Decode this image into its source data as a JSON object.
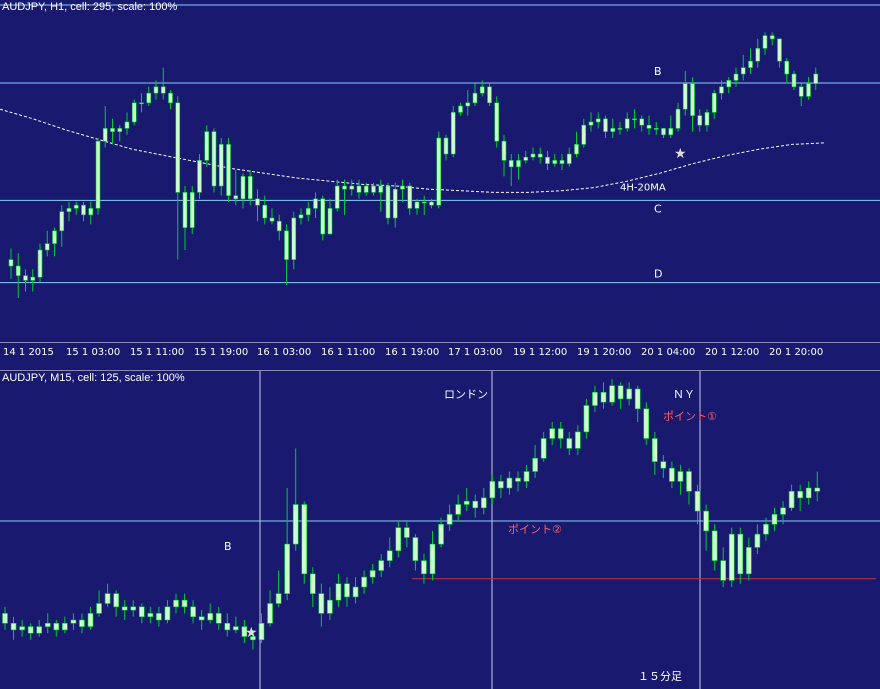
{
  "colors": {
    "background": "#191970",
    "bull": "#ccffcc",
    "bear": "#ccffcc",
    "wick": "#00cc33",
    "level": "#87cefa",
    "vline": "#c8c8e8",
    "ma": "#ffffff",
    "red_line": "#cc3333",
    "point_text": "#ff6060",
    "label_text": "#ffffff"
  },
  "h1": {
    "title": "AUDJPY, H1, cell: 295, scale: 100%",
    "x_ticks": [
      "14 1 2015",
      "15 1 03:00",
      "15 1 11:00",
      "15 1 19:00",
      "16 1 03:00",
      "16 1 11:00",
      "16 1 19:00",
      "17 1 03:00",
      "19 1 12:00",
      "19 1 20:00",
      "20 1 04:00",
      "20 1 12:00",
      "20 1 20:00"
    ],
    "level_B": "B",
    "level_C": "C",
    "level_D": "D",
    "ma_label": "4H-20MA",
    "star": "★"
  },
  "m15": {
    "title": "AUDJPY, M15, cell: 125, scale: 100%",
    "label_london": "ロンドン",
    "label_ny": "ＮＹ",
    "label_point1": "ポイント①",
    "label_point2": "ポイント②",
    "label_b": "B",
    "label_15": "１５分足",
    "star": "★"
  },
  "chart_data": [
    {
      "type": "candlestick",
      "title": "AUDJPY, H1, cell: 295, scale: 100%",
      "ylim": [
        0,
        1
      ],
      "levels": [
        {
          "name": "B",
          "y": 0.772
        },
        {
          "name": "C",
          "y": 0.405
        },
        {
          "name": "D",
          "y": 0.148
        }
      ],
      "ma_name": "4H-20MA",
      "ma": [
        0.69,
        0.66,
        0.625,
        0.595,
        0.565,
        0.545,
        0.525,
        0.505,
        0.49,
        0.475,
        0.465,
        0.455,
        0.45,
        0.44,
        0.435,
        0.43,
        0.43,
        0.435,
        0.445,
        0.465,
        0.49,
        0.52,
        0.545,
        0.565,
        0.58,
        0.585
      ],
      "candles": [
        [
          0.22,
          0.2,
          0.255,
          0.16
        ],
        [
          0.2,
          0.17,
          0.24,
          0.1
        ],
        [
          0.17,
          0.155,
          0.19,
          0.12
        ],
        [
          0.155,
          0.165,
          0.19,
          0.12
        ],
        [
          0.165,
          0.25,
          0.27,
          0.15
        ],
        [
          0.25,
          0.27,
          0.31,
          0.23
        ],
        [
          0.27,
          0.31,
          0.32,
          0.23
        ],
        [
          0.31,
          0.37,
          0.39,
          0.26
        ],
        [
          0.37,
          0.38,
          0.4,
          0.34
        ],
        [
          0.38,
          0.39,
          0.4,
          0.36
        ],
        [
          0.39,
          0.36,
          0.4,
          0.34
        ],
        [
          0.36,
          0.38,
          0.4,
          0.33
        ],
        [
          0.38,
          0.59,
          0.6,
          0.36
        ],
        [
          0.59,
          0.63,
          0.7,
          0.57
        ],
        [
          0.63,
          0.62,
          0.66,
          0.58
        ],
        [
          0.62,
          0.63,
          0.64,
          0.59
        ],
        [
          0.63,
          0.65,
          0.68,
          0.61
        ],
        [
          0.65,
          0.71,
          0.72,
          0.64
        ],
        [
          0.71,
          0.71,
          0.74,
          0.68
        ],
        [
          0.71,
          0.74,
          0.76,
          0.7
        ],
        [
          0.74,
          0.76,
          0.78,
          0.72
        ],
        [
          0.76,
          0.74,
          0.82,
          0.72
        ],
        [
          0.74,
          0.71,
          0.75,
          0.69
        ],
        [
          0.71,
          0.43,
          0.73,
          0.22
        ],
        [
          0.43,
          0.32,
          0.45,
          0.25
        ],
        [
          0.32,
          0.43,
          0.45,
          0.3
        ],
        [
          0.43,
          0.53,
          0.55,
          0.41
        ],
        [
          0.53,
          0.62,
          0.64,
          0.51
        ],
        [
          0.62,
          0.45,
          0.63,
          0.43
        ],
        [
          0.45,
          0.58,
          0.6,
          0.42
        ],
        [
          0.58,
          0.42,
          0.6,
          0.4
        ],
        [
          0.42,
          0.41,
          0.5,
          0.39
        ],
        [
          0.41,
          0.48,
          0.49,
          0.38
        ],
        [
          0.48,
          0.41,
          0.5,
          0.39
        ],
        [
          0.41,
          0.39,
          0.44,
          0.34
        ],
        [
          0.39,
          0.35,
          0.42,
          0.33
        ],
        [
          0.35,
          0.34,
          0.38,
          0.33
        ],
        [
          0.34,
          0.31,
          0.36,
          0.28
        ],
        [
          0.31,
          0.22,
          0.33,
          0.14
        ],
        [
          0.22,
          0.35,
          0.37,
          0.19
        ],
        [
          0.35,
          0.36,
          0.38,
          0.33
        ],
        [
          0.36,
          0.38,
          0.4,
          0.34
        ],
        [
          0.38,
          0.41,
          0.43,
          0.35
        ],
        [
          0.41,
          0.3,
          0.42,
          0.28
        ],
        [
          0.3,
          0.38,
          0.41,
          0.36
        ],
        [
          0.38,
          0.45,
          0.47,
          0.37
        ],
        [
          0.45,
          0.44,
          0.47,
          0.36
        ],
        [
          0.44,
          0.45,
          0.47,
          0.42
        ],
        [
          0.45,
          0.43,
          0.47,
          0.41
        ],
        [
          0.43,
          0.45,
          0.46,
          0.42
        ],
        [
          0.45,
          0.43,
          0.46,
          0.42
        ],
        [
          0.43,
          0.45,
          0.47,
          0.37
        ],
        [
          0.45,
          0.35,
          0.46,
          0.33
        ],
        [
          0.35,
          0.44,
          0.46,
          0.32
        ],
        [
          0.44,
          0.45,
          0.47,
          0.4
        ],
        [
          0.45,
          0.38,
          0.46,
          0.36
        ],
        [
          0.38,
          0.4,
          0.41,
          0.36
        ],
        [
          0.4,
          0.4,
          0.42,
          0.36
        ],
        [
          0.4,
          0.39,
          0.41,
          0.38
        ],
        [
          0.39,
          0.6,
          0.62,
          0.38
        ],
        [
          0.6,
          0.55,
          0.61,
          0.53
        ],
        [
          0.55,
          0.68,
          0.7,
          0.54
        ],
        [
          0.68,
          0.7,
          0.71,
          0.67
        ],
        [
          0.7,
          0.71,
          0.75,
          0.67
        ],
        [
          0.71,
          0.74,
          0.77,
          0.7
        ],
        [
          0.74,
          0.76,
          0.78,
          0.73
        ],
        [
          0.76,
          0.71,
          0.77,
          0.7
        ],
        [
          0.71,
          0.59,
          0.73,
          0.57
        ],
        [
          0.59,
          0.53,
          0.61,
          0.48
        ],
        [
          0.53,
          0.51,
          0.55,
          0.45
        ],
        [
          0.51,
          0.53,
          0.55,
          0.47
        ],
        [
          0.53,
          0.54,
          0.56,
          0.52
        ],
        [
          0.54,
          0.55,
          0.57,
          0.53
        ],
        [
          0.55,
          0.54,
          0.57,
          0.52
        ],
        [
          0.54,
          0.52,
          0.56,
          0.5
        ],
        [
          0.52,
          0.53,
          0.55,
          0.51
        ],
        [
          0.53,
          0.52,
          0.55,
          0.5
        ],
        [
          0.52,
          0.55,
          0.57,
          0.51
        ],
        [
          0.55,
          0.58,
          0.62,
          0.54
        ],
        [
          0.58,
          0.64,
          0.66,
          0.57
        ],
        [
          0.64,
          0.65,
          0.68,
          0.62
        ],
        [
          0.65,
          0.66,
          0.68,
          0.63
        ],
        [
          0.66,
          0.62,
          0.67,
          0.6
        ],
        [
          0.62,
          0.63,
          0.66,
          0.6
        ],
        [
          0.63,
          0.63,
          0.65,
          0.61
        ],
        [
          0.63,
          0.66,
          0.68,
          0.62
        ],
        [
          0.66,
          0.66,
          0.69,
          0.63
        ],
        [
          0.66,
          0.64,
          0.67,
          0.62
        ],
        [
          0.64,
          0.63,
          0.67,
          0.61
        ],
        [
          0.63,
          0.63,
          0.65,
          0.61
        ],
        [
          0.63,
          0.61,
          0.63,
          0.6
        ],
        [
          0.61,
          0.63,
          0.67,
          0.6
        ],
        [
          0.63,
          0.69,
          0.71,
          0.62
        ],
        [
          0.69,
          0.77,
          0.81,
          0.67
        ],
        [
          0.77,
          0.67,
          0.79,
          0.62
        ],
        [
          0.67,
          0.64,
          0.69,
          0.62
        ],
        [
          0.64,
          0.68,
          0.69,
          0.62
        ],
        [
          0.68,
          0.74,
          0.75,
          0.66
        ],
        [
          0.74,
          0.76,
          0.78,
          0.72
        ],
        [
          0.76,
          0.78,
          0.79,
          0.74
        ],
        [
          0.78,
          0.8,
          0.82,
          0.76
        ],
        [
          0.8,
          0.82,
          0.86,
          0.78
        ],
        [
          0.82,
          0.84,
          0.88,
          0.8
        ],
        [
          0.84,
          0.88,
          0.91,
          0.82
        ],
        [
          0.88,
          0.92,
          0.93,
          0.86
        ],
        [
          0.92,
          0.91,
          0.93,
          0.89
        ],
        [
          0.91,
          0.84,
          0.91,
          0.82
        ],
        [
          0.84,
          0.8,
          0.85,
          0.77
        ],
        [
          0.8,
          0.76,
          0.81,
          0.75
        ],
        [
          0.76,
          0.73,
          0.77,
          0.7
        ],
        [
          0.73,
          0.77,
          0.79,
          0.72
        ],
        [
          0.77,
          0.8,
          0.82,
          0.75
        ]
      ]
    },
    {
      "type": "candlestick",
      "title": "AUDJPY, M15, cell: 125, scale: 100%",
      "ylim": [
        0,
        1
      ],
      "levels": [
        {
          "name": "B",
          "y": 0.5
        },
        {
          "name": "red_support",
          "y": 0.325
        }
      ],
      "annotations": [
        "ロンドン",
        "ＮＹ",
        "ポイント①",
        "ポイント②",
        "１５分足"
      ],
      "candles": [
        [
          0.22,
          0.19,
          0.24,
          0.17
        ],
        [
          0.19,
          0.17,
          0.21,
          0.14
        ],
        [
          0.17,
          0.18,
          0.2,
          0.15
        ],
        [
          0.18,
          0.16,
          0.19,
          0.14
        ],
        [
          0.16,
          0.18,
          0.2,
          0.15
        ],
        [
          0.18,
          0.19,
          0.22,
          0.16
        ],
        [
          0.19,
          0.17,
          0.2,
          0.15
        ],
        [
          0.17,
          0.19,
          0.21,
          0.16
        ],
        [
          0.19,
          0.2,
          0.22,
          0.17
        ],
        [
          0.2,
          0.18,
          0.22,
          0.16
        ],
        [
          0.18,
          0.22,
          0.24,
          0.17
        ],
        [
          0.22,
          0.25,
          0.29,
          0.21
        ],
        [
          0.25,
          0.28,
          0.31,
          0.24
        ],
        [
          0.28,
          0.24,
          0.29,
          0.21
        ],
        [
          0.24,
          0.23,
          0.26,
          0.2
        ],
        [
          0.23,
          0.24,
          0.26,
          0.21
        ],
        [
          0.24,
          0.21,
          0.25,
          0.19
        ],
        [
          0.21,
          0.22,
          0.24,
          0.19
        ],
        [
          0.22,
          0.2,
          0.24,
          0.18
        ],
        [
          0.2,
          0.24,
          0.26,
          0.19
        ],
        [
          0.24,
          0.26,
          0.28,
          0.22
        ],
        [
          0.26,
          0.24,
          0.28,
          0.22
        ],
        [
          0.24,
          0.21,
          0.26,
          0.19
        ],
        [
          0.21,
          0.2,
          0.23,
          0.17
        ],
        [
          0.2,
          0.22,
          0.25,
          0.19
        ],
        [
          0.22,
          0.19,
          0.24,
          0.17
        ],
        [
          0.19,
          0.17,
          0.22,
          0.15
        ],
        [
          0.17,
          0.18,
          0.21,
          0.16
        ],
        [
          0.18,
          0.15,
          0.2,
          0.13
        ],
        [
          0.15,
          0.14,
          0.17,
          0.11
        ],
        [
          0.14,
          0.19,
          0.22,
          0.13
        ],
        [
          0.19,
          0.25,
          0.29,
          0.18
        ],
        [
          0.25,
          0.28,
          0.35,
          0.24
        ],
        [
          0.28,
          0.43,
          0.6,
          0.26
        ],
        [
          0.43,
          0.55,
          0.72,
          0.41
        ],
        [
          0.55,
          0.34,
          0.56,
          0.31
        ],
        [
          0.34,
          0.28,
          0.36,
          0.24
        ],
        [
          0.28,
          0.22,
          0.31,
          0.18
        ],
        [
          0.22,
          0.26,
          0.3,
          0.2
        ],
        [
          0.26,
          0.31,
          0.34,
          0.24
        ],
        [
          0.31,
          0.27,
          0.33,
          0.24
        ],
        [
          0.27,
          0.3,
          0.33,
          0.25
        ],
        [
          0.3,
          0.33,
          0.35,
          0.28
        ],
        [
          0.33,
          0.35,
          0.37,
          0.31
        ],
        [
          0.35,
          0.38,
          0.4,
          0.33
        ],
        [
          0.38,
          0.41,
          0.45,
          0.36
        ],
        [
          0.41,
          0.48,
          0.5,
          0.39
        ],
        [
          0.48,
          0.45,
          0.5,
          0.42
        ],
        [
          0.45,
          0.38,
          0.46,
          0.35
        ],
        [
          0.38,
          0.34,
          0.4,
          0.31
        ],
        [
          0.34,
          0.43,
          0.47,
          0.32
        ],
        [
          0.43,
          0.49,
          0.51,
          0.42
        ],
        [
          0.49,
          0.52,
          0.55,
          0.47
        ],
        [
          0.52,
          0.55,
          0.58,
          0.5
        ],
        [
          0.55,
          0.56,
          0.6,
          0.53
        ],
        [
          0.56,
          0.54,
          0.58,
          0.51
        ],
        [
          0.54,
          0.57,
          0.6,
          0.52
        ],
        [
          0.57,
          0.62,
          0.64,
          0.55
        ],
        [
          0.62,
          0.6,
          0.64,
          0.57
        ],
        [
          0.6,
          0.63,
          0.65,
          0.58
        ],
        [
          0.63,
          0.62,
          0.65,
          0.59
        ],
        [
          0.62,
          0.65,
          0.67,
          0.6
        ],
        [
          0.65,
          0.69,
          0.73,
          0.63
        ],
        [
          0.69,
          0.75,
          0.77,
          0.68
        ],
        [
          0.75,
          0.78,
          0.8,
          0.73
        ],
        [
          0.78,
          0.75,
          0.8,
          0.72
        ],
        [
          0.75,
          0.72,
          0.77,
          0.7
        ],
        [
          0.72,
          0.77,
          0.79,
          0.7
        ],
        [
          0.77,
          0.85,
          0.87,
          0.75
        ],
        [
          0.85,
          0.89,
          0.91,
          0.83
        ],
        [
          0.89,
          0.86,
          0.92,
          0.84
        ],
        [
          0.86,
          0.91,
          0.93,
          0.85
        ],
        [
          0.91,
          0.87,
          0.92,
          0.84
        ],
        [
          0.87,
          0.9,
          0.92,
          0.85
        ],
        [
          0.9,
          0.84,
          0.91,
          0.8
        ],
        [
          0.84,
          0.75,
          0.86,
          0.73
        ],
        [
          0.75,
          0.68,
          0.77,
          0.64
        ],
        [
          0.68,
          0.66,
          0.7,
          0.63
        ],
        [
          0.66,
          0.62,
          0.68,
          0.6
        ],
        [
          0.62,
          0.65,
          0.67,
          0.58
        ],
        [
          0.65,
          0.59,
          0.66,
          0.55
        ],
        [
          0.59,
          0.53,
          0.61,
          0.49
        ],
        [
          0.53,
          0.47,
          0.55,
          0.41
        ],
        [
          0.47,
          0.38,
          0.49,
          0.35
        ],
        [
          0.38,
          0.32,
          0.42,
          0.3
        ],
        [
          0.32,
          0.46,
          0.48,
          0.3
        ],
        [
          0.46,
          0.34,
          0.48,
          0.31
        ],
        [
          0.34,
          0.42,
          0.45,
          0.32
        ],
        [
          0.42,
          0.46,
          0.49,
          0.4
        ],
        [
          0.46,
          0.49,
          0.51,
          0.44
        ],
        [
          0.49,
          0.52,
          0.54,
          0.47
        ],
        [
          0.52,
          0.54,
          0.56,
          0.49
        ],
        [
          0.54,
          0.59,
          0.61,
          0.53
        ],
        [
          0.59,
          0.57,
          0.61,
          0.53
        ],
        [
          0.57,
          0.6,
          0.62,
          0.55
        ],
        [
          0.6,
          0.59,
          0.65,
          0.56
        ]
      ]
    }
  ]
}
